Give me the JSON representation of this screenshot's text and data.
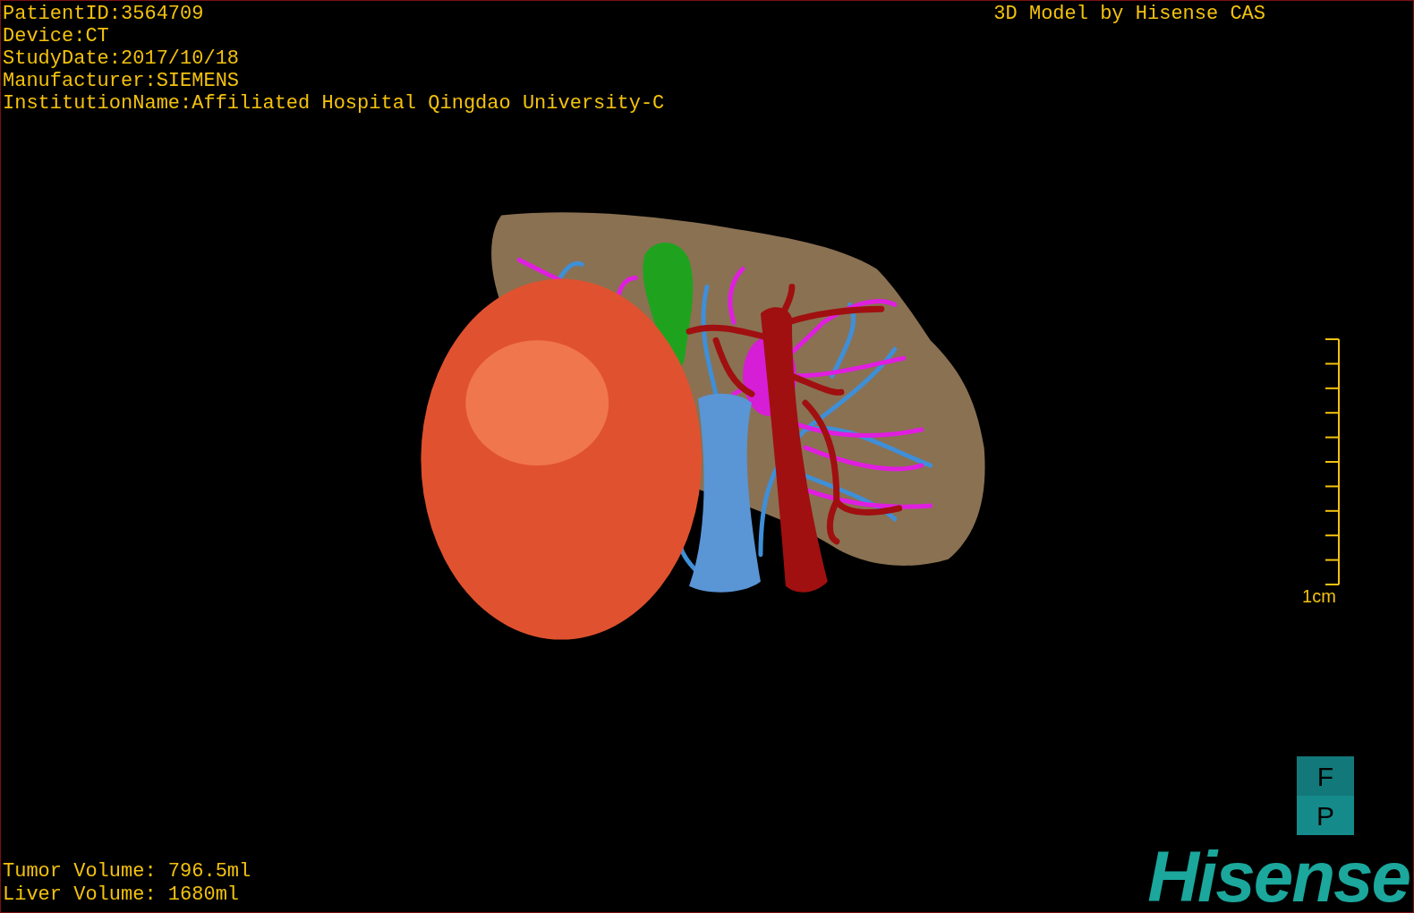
{
  "patient_info": [
    "PatientID:3564709",
    "Device:CT",
    "StudyDate:2017/10/18",
    "Manufacturer:SIEMENS",
    "InstitutionName:Affiliated Hospital Qingdao University-C"
  ],
  "title": "3D Model by Hisense CAS",
  "scale_bar": {
    "label": "1cm"
  },
  "orientation": [
    "F",
    "P"
  ],
  "volumes": [
    "Tumor Volume: 796.5ml",
    "Liver Volume: 1680ml"
  ],
  "logo": "Hisense"
}
